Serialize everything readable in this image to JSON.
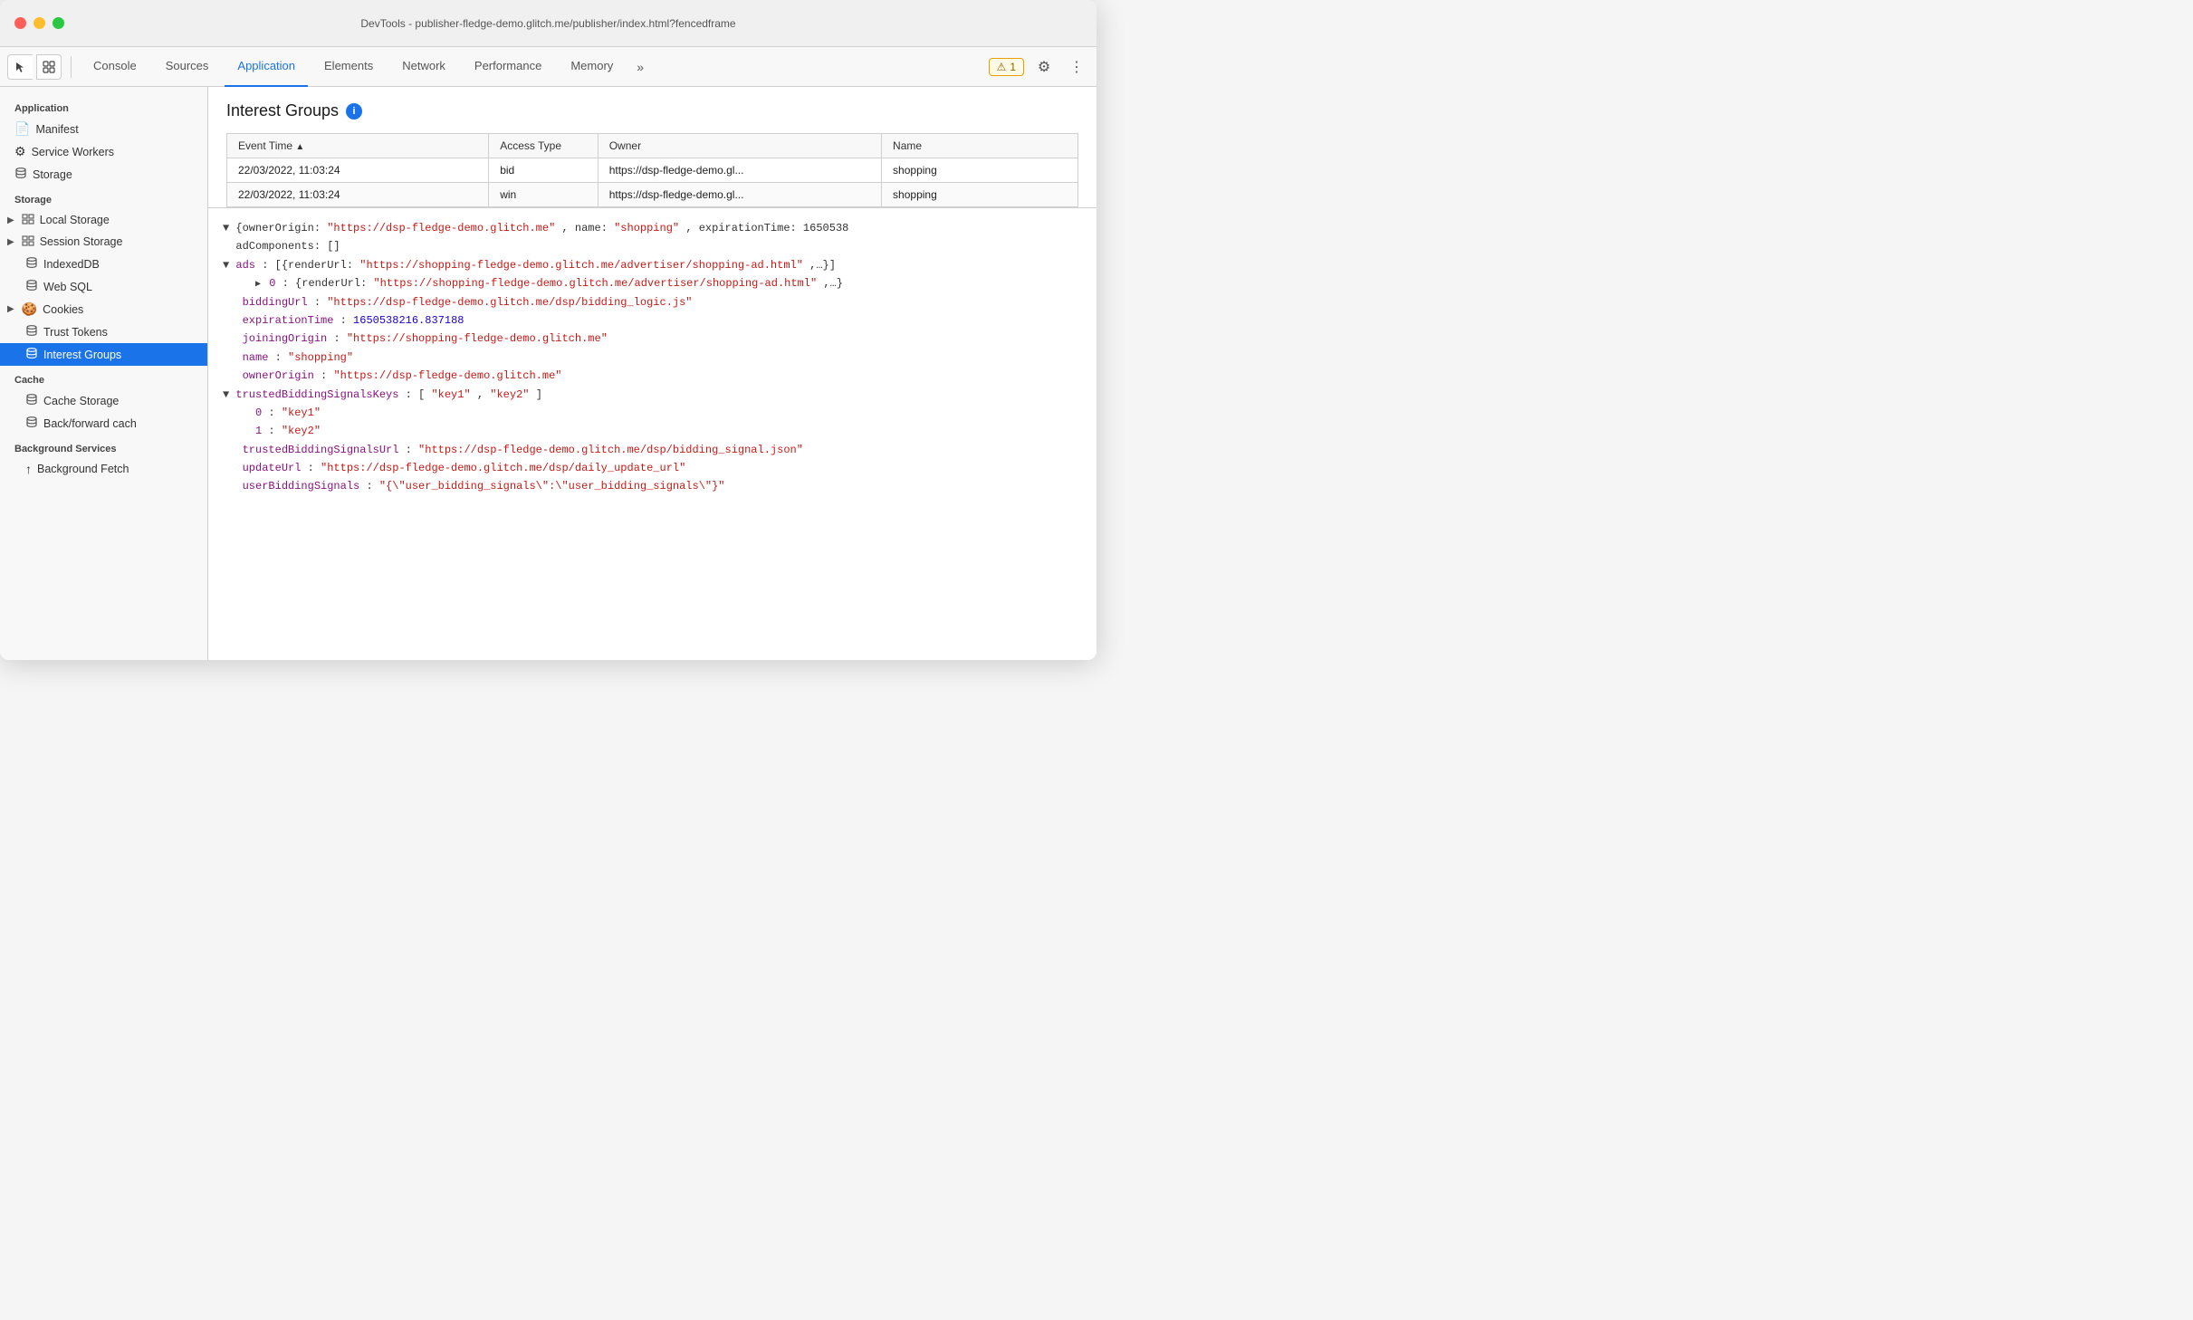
{
  "window": {
    "title": "DevTools - publisher-fledge-demo.glitch.me/publisher/index.html?fencedframe"
  },
  "toolbar": {
    "tabs": [
      {
        "id": "console",
        "label": "Console",
        "active": false
      },
      {
        "id": "sources",
        "label": "Sources",
        "active": false
      },
      {
        "id": "application",
        "label": "Application",
        "active": true
      },
      {
        "id": "elements",
        "label": "Elements",
        "active": false
      },
      {
        "id": "network",
        "label": "Network",
        "active": false
      },
      {
        "id": "performance",
        "label": "Performance",
        "active": false
      },
      {
        "id": "memory",
        "label": "Memory",
        "active": false
      }
    ],
    "more_label": "»",
    "warning_count": "1",
    "gear_icon": "⚙",
    "dots_icon": "⋮"
  },
  "sidebar": {
    "sections": [
      {
        "label": "Application",
        "items": [
          {
            "id": "manifest",
            "label": "Manifest",
            "icon": "📄",
            "indent": 1
          },
          {
            "id": "service-workers",
            "label": "Service Workers",
            "icon": "⚙",
            "indent": 1
          },
          {
            "id": "storage",
            "label": "Storage",
            "icon": "🗄",
            "indent": 1
          }
        ]
      },
      {
        "label": "Storage",
        "items": [
          {
            "id": "local-storage",
            "label": "Local Storage",
            "icon": "▶",
            "icon2": "▦",
            "indent": 1,
            "chevron": true
          },
          {
            "id": "session-storage",
            "label": "Session Storage",
            "icon": "▶",
            "icon2": "▦",
            "indent": 1,
            "chevron": true
          },
          {
            "id": "indexeddb",
            "label": "IndexedDB",
            "icon": "🗄",
            "indent": 1
          },
          {
            "id": "web-sql",
            "label": "Web SQL",
            "icon": "🗄",
            "indent": 1
          },
          {
            "id": "cookies",
            "label": "Cookies",
            "icon": "▶",
            "icon2": "🍪",
            "indent": 1,
            "chevron": true
          },
          {
            "id": "trust-tokens",
            "label": "Trust Tokens",
            "icon": "🗄",
            "indent": 1
          },
          {
            "id": "interest-groups",
            "label": "Interest Groups",
            "icon": "🗄",
            "indent": 1,
            "active": true
          }
        ]
      },
      {
        "label": "Cache",
        "items": [
          {
            "id": "cache-storage",
            "label": "Cache Storage",
            "icon": "🗄",
            "indent": 1
          },
          {
            "id": "back-forward-cache",
            "label": "Back/forward cach",
            "icon": "🗄",
            "indent": 1
          }
        ]
      },
      {
        "label": "Background Services",
        "items": [
          {
            "id": "background-fetch",
            "label": "Background Fetch",
            "icon": "↑",
            "indent": 1
          }
        ]
      }
    ]
  },
  "interest_groups": {
    "title": "Interest Groups",
    "table": {
      "columns": [
        "Event Time",
        "Access Type",
        "Owner",
        "Name"
      ],
      "rows": [
        {
          "event_time": "22/03/2022, 11:03:24",
          "access_type": "bid",
          "owner": "https://dsp-fledge-demo.gl...",
          "name": "shopping"
        },
        {
          "event_time": "22/03/2022, 11:03:24",
          "access_type": "win",
          "owner": "https://dsp-fledge-demo.gl...",
          "name": "shopping"
        }
      ]
    },
    "detail": {
      "line1": "{ownerOrigin: \"https://dsp-fledge-demo.glitch.me\", name: \"shopping\", expirationTime: 1650538",
      "line2": "  adComponents: []",
      "line3": "▼ ads: [{renderUrl: \"https://shopping-fledge-demo.glitch.me/advertiser/shopping-ad.html\",…}]",
      "line4": "    ▶ 0: {renderUrl: \"https://shopping-fledge-demo.glitch.me/advertiser/shopping-ad.html\",…}",
      "line5_key": "  biddingUrl: ",
      "line5_val": "\"https://dsp-fledge-demo.glitch.me/dsp/bidding_logic.js\"",
      "line6_key": "  expirationTime: ",
      "line6_val": "1650538216.837188",
      "line7_key": "  joiningOrigin: ",
      "line7_val": "\"https://shopping-fledge-demo.glitch.me\"",
      "line8_key": "  name: ",
      "line8_val": "\"shopping\"",
      "line9_key": "  ownerOrigin: ",
      "line9_val": "\"https://dsp-fledge-demo.glitch.me\"",
      "line10": "▼ trustedBiddingSignalsKeys: [\"key1\", \"key2\"]",
      "line11_key": "    0: ",
      "line11_val": "\"key1\"",
      "line12_key": "    1: ",
      "line12_val": "\"key2\"",
      "line13_key": "  trustedBiddingSignalsUrl: ",
      "line13_val": "\"https://dsp-fledge-demo.glitch.me/dsp/bidding_signal.json\"",
      "line14_key": "  updateUrl: ",
      "line14_val": "\"https://dsp-fledge-demo.glitch.me/dsp/daily_update_url\"",
      "line15_key": "  userBiddingSignals: ",
      "line15_val": "\"{\\\"user_bidding_signals\\\":\\\"user_bidding_signals\\\"}\""
    }
  }
}
